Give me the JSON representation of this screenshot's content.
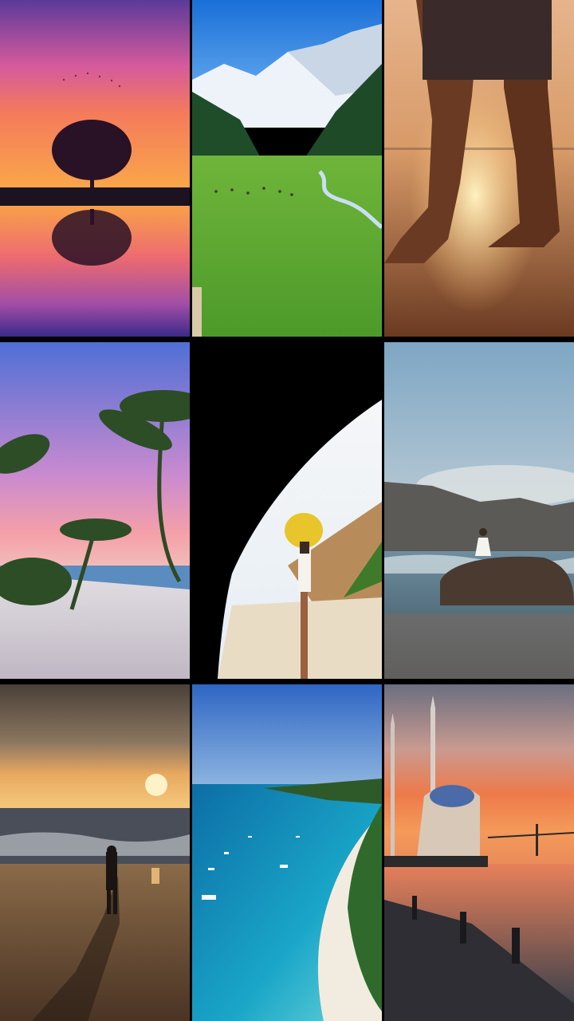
{
  "grid": {
    "tiles": [
      {
        "scene": "tree-sunset-reflection"
      },
      {
        "scene": "mountain-valley-meadow"
      },
      {
        "scene": "feet-walking-beach-sunset"
      },
      {
        "scene": "palm-trees-beach"
      },
      {
        "scene": "page-curl-transition-woman-yellow-hat"
      },
      {
        "scene": "woman-on-rock-by-sea"
      },
      {
        "scene": "woman-on-beach-at-sunset"
      },
      {
        "scene": "aerial-turquoise-coast"
      },
      {
        "scene": "mosque-by-bridge-at-sunset"
      }
    ]
  }
}
